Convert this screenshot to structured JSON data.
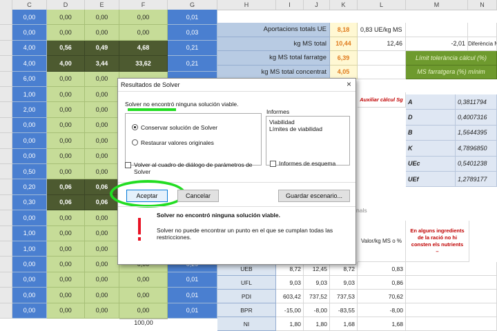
{
  "columns": [
    "C",
    "D",
    "E",
    "F",
    "G",
    "H",
    "I",
    "J",
    "K",
    "L",
    "M",
    "N"
  ],
  "left_rows": [
    {
      "c": "0,00",
      "d": "0,00",
      "e": "0,00",
      "f": "0,00",
      "g": "0,01",
      "dark": false
    },
    {
      "c": "0,00",
      "d": "0,00",
      "e": "0,00",
      "f": "0,00",
      "g": "0,03",
      "dark": false
    },
    {
      "c": "4,00",
      "d": "0,56",
      "e": "0,49",
      "f": "4,68",
      "g": "0,21",
      "dark": true
    },
    {
      "c": "4,00",
      "d": "4,00",
      "e": "3,44",
      "f": "33,62",
      "g": "0,21",
      "dark": true
    },
    {
      "c": "6,00",
      "d": "0,00",
      "e": "0,00",
      "f": "",
      "g": "",
      "dark": false
    },
    {
      "c": "1,00",
      "d": "0,00",
      "e": "0,00",
      "f": "",
      "g": "",
      "dark": false
    },
    {
      "c": "2,00",
      "d": "0,00",
      "e": "0,00",
      "f": "",
      "g": "",
      "dark": false
    },
    {
      "c": "0,00",
      "d": "0,00",
      "e": "0,00",
      "f": "",
      "g": "",
      "dark": false
    },
    {
      "c": "0,00",
      "d": "0,00",
      "e": "0,00",
      "f": "",
      "g": "",
      "dark": false
    },
    {
      "c": "0,00",
      "d": "0,00",
      "e": "0,00",
      "f": "",
      "g": "",
      "dark": false
    },
    {
      "c": "0,50",
      "d": "0,00",
      "e": "0,00",
      "f": "",
      "g": "",
      "dark": false
    },
    {
      "c": "0,20",
      "d": "0,06",
      "e": "0,06",
      "f": "",
      "g": "",
      "dark": true
    },
    {
      "c": "0,30",
      "d": "0,06",
      "e": "0,06",
      "f": "",
      "g": "",
      "dark": true
    },
    {
      "c": "0,00",
      "d": "0,00",
      "e": "0,00",
      "f": "",
      "g": "",
      "dark": false
    },
    {
      "c": "1,00",
      "d": "0,00",
      "e": "0,00",
      "f": "",
      "g": "",
      "dark": false
    },
    {
      "c": "1,00",
      "d": "0,00",
      "e": "0,00",
      "f": "",
      "g": "",
      "dark": false
    },
    {
      "c": "0,00",
      "d": "0,00",
      "e": "0,00",
      "f": "0,00",
      "g": "0,29",
      "dark": false
    },
    {
      "c": "0,00",
      "d": "0,00",
      "e": "0,00",
      "f": "0,00",
      "g": "0,01",
      "dark": false
    },
    {
      "c": "0,00",
      "d": "0,00",
      "e": "0,00",
      "f": "0,00",
      "g": "0,01",
      "dark": false
    },
    {
      "c": "0,00",
      "d": "0,00",
      "e": "0,00",
      "f": "0,00",
      "g": "0,01",
      "dark": false
    }
  ],
  "bottom_total": "100,00",
  "top_right": [
    {
      "label": "Aportacions totals UE",
      "k": "8,18",
      "l": "0,83 UE/kg MS",
      "m": "",
      "n": ""
    },
    {
      "label": "kg MS total",
      "k": "10,44",
      "l": "12,46",
      "m": "-2,01",
      "n": "Diferència M"
    },
    {
      "label": "kg MS total farratge",
      "k": "6,39",
      "l": "",
      "m": "Límit tolerància càlcul (%)",
      "n": ""
    },
    {
      "label": "kg MS total concentrat",
      "k": "4,05",
      "l": "",
      "m": "MS farratgera (%) mínim",
      "n": ""
    }
  ],
  "aux": {
    "header": "Auxiliar càlcul Sg",
    "rows": [
      {
        "key": "A",
        "val": "0,3811794"
      },
      {
        "key": "D",
        "val": "0,4007316"
      },
      {
        "key": "B",
        "val": "1,5644395"
      },
      {
        "key": "K",
        "val": "4,7896850"
      },
      {
        "key": "UEc",
        "val": "0,5401238"
      },
      {
        "key": "UEf",
        "val": "1,2789177"
      }
    ]
  },
  "nutrients": {
    "section_fragment": "nals",
    "col_header": "Valor/kg MS o %",
    "warning": "En alguns ingredients de la ració no hi consten els nutrients",
    "warning_dash": "–",
    "rows": [
      {
        "name": "UEB",
        "i": "8,72",
        "j": "12,45",
        "k": "8,72",
        "l": "0,83"
      },
      {
        "name": "UFL",
        "i": "9,03",
        "j": "9,03",
        "k": "9,03",
        "l": "0,86"
      },
      {
        "name": "PDI",
        "i": "603,42",
        "j": "737,52",
        "k": "737,53",
        "l": "70,62"
      },
      {
        "name": "BPR",
        "i": "-15,00",
        "j": "-8,00",
        "k": "-83,55",
        "l": "-8,00"
      },
      {
        "name": "NI",
        "i": "1,80",
        "j": "1,80",
        "k": "1,68",
        "l": "1,68"
      }
    ]
  },
  "dialog": {
    "title": "Resultados de Solver",
    "close": "×",
    "message": "Solver no encontró ninguna solución viable.",
    "opt_keep": "Conservar solución de Solver",
    "opt_restore": "Restaurar valores originales",
    "reports_label": "Informes",
    "reports": [
      "Viabilidad",
      "Límites de viabilidad"
    ],
    "return_check": "Volver al cuadro de diálogo de parámetros de Solver",
    "outline_check": "Informes de esquema",
    "btn_accept": "Aceptar",
    "btn_cancel": "Cancelar",
    "btn_save": "Guardar escenario...",
    "detail_title": "Solver no encontró ninguna solución viable.",
    "detail_text": "Solver no puede encontrar un punto en el que se cumplan todas las restricciones.",
    "icon": "exclamation-icon"
  },
  "colors": {
    "blue": "#4a7fd0",
    "light_green": "#c6dc98",
    "dark_green": "#4d5a30",
    "highlight": "#22dd22"
  }
}
